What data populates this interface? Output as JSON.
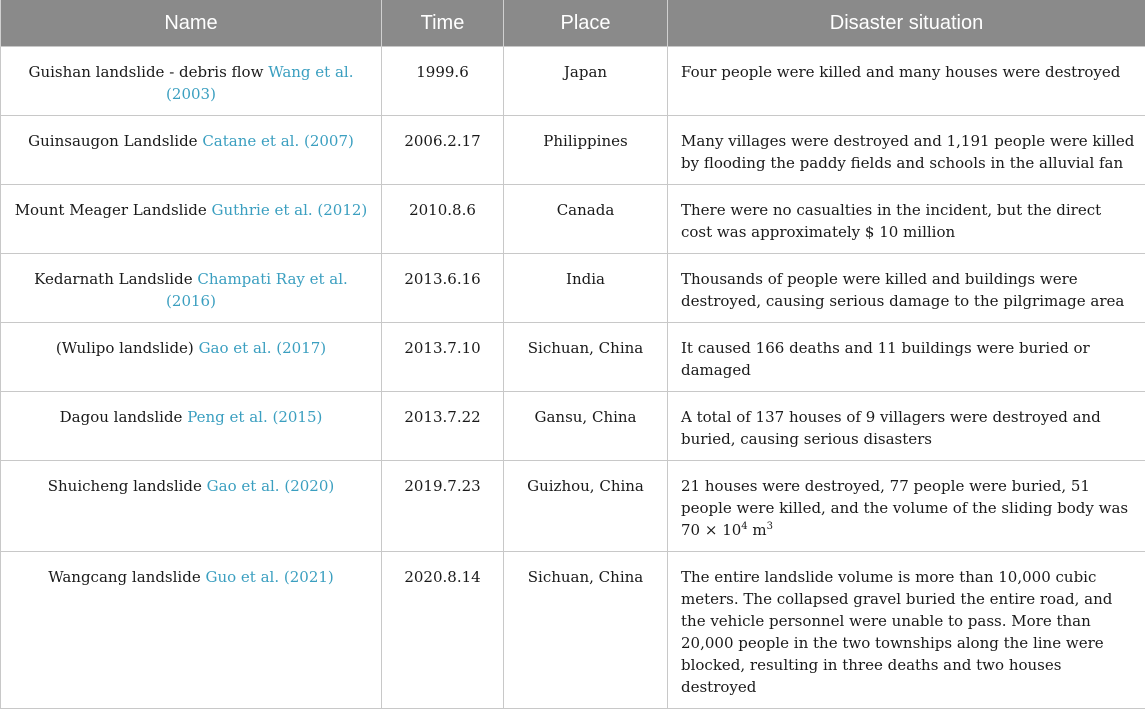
{
  "headers": {
    "name": "Name",
    "time": "Time",
    "place": "Place",
    "situation": "Disaster situation"
  },
  "rows": [
    {
      "name": "Guishan landslide - debris flow",
      "citation": "Wang et al. (2003)",
      "time": "1999.6",
      "place": "Japan",
      "situation": "Four people were killed and many houses were destroyed"
    },
    {
      "name": "Guinsaugon Landslide",
      "citation": "Catane et al. (2007)",
      "time": "2006.2.17",
      "place": "Philippines",
      "situation": "Many villages were destroyed and 1,191 people were killed by flooding the paddy fields and schools in the alluvial fan"
    },
    {
      "name": "Mount Meager Landslide",
      "citation": "Guthrie et al. (2012)",
      "time": "2010.8.6",
      "place": "Canada",
      "situation": "There were no casualties in the incident, but the direct cost was approximately $ 10 million"
    },
    {
      "name": "Kedarnath Landslide",
      "citation": "Champati Ray et al. (2016)",
      "time": "2013.6.16",
      "place": "India",
      "situation": "Thousands of people were killed and buildings were destroyed, causing serious damage to the pilgrimage area"
    },
    {
      "name": "(Wulipo landslide)",
      "citation": "Gao et al. (2017)",
      "time": "2013.7.10",
      "place": "Sichuan, China",
      "situation": "It caused 166 deaths and 11 buildings were buried or damaged"
    },
    {
      "name": "Dagou landslide",
      "citation": "Peng et al. (2015)",
      "time": "2013.7.22",
      "place": "Gansu, China",
      "situation": "A total of 137 houses of 9 villagers were destroyed and buried, causing serious disasters"
    },
    {
      "name": "Shuicheng landslide",
      "citation": "Gao et al. (2020)",
      "time": "2019.7.23",
      "place": "Guizhou, China",
      "situation_main": "21 houses were destroyed, 77 people were buried, 51 people were killed, and the volume of the sliding body was 70 × 10",
      "situation_exp": "4",
      "situation_unit": " m",
      "situation_unit_exp": "3"
    },
    {
      "name": "Wangcang landslide",
      "citation": "Guo et al. (2021)",
      "time": "2020.8.14",
      "place": "Sichuan, China",
      "situation": "The entire landslide volume is more than 10,000 cubic meters. The collapsed gravel buried the entire road, and the vehicle personnel were unable to pass. More than 20,000 people in the two townships along the line were blocked, resulting in three deaths and two houses destroyed"
    }
  ]
}
